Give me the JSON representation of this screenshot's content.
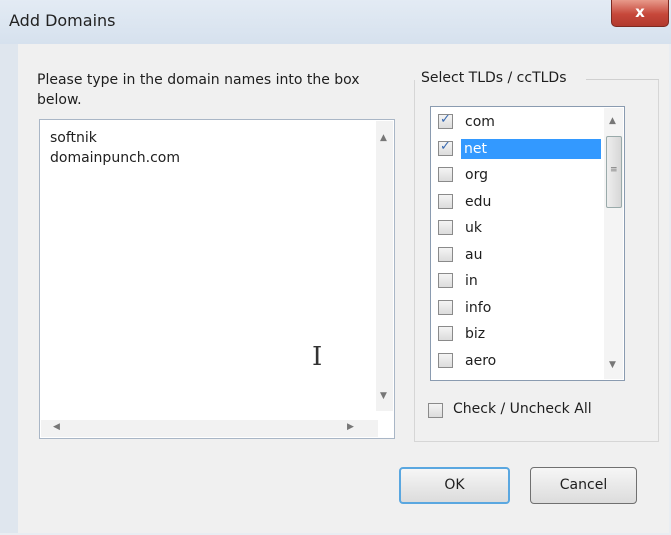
{
  "window": {
    "title": "Add Domains",
    "close_glyph": "x"
  },
  "prompt": "Please type in the domain names into the box below.",
  "textarea_lines": [
    "softnik",
    "domainpunch.com"
  ],
  "tld_group": {
    "label": "Select TLDs / ccTLDs",
    "items": [
      {
        "label": "com",
        "checked": true,
        "selected": false
      },
      {
        "label": "net",
        "checked": true,
        "selected": true
      },
      {
        "label": "org",
        "checked": false,
        "selected": false
      },
      {
        "label": "edu",
        "checked": false,
        "selected": false
      },
      {
        "label": "uk",
        "checked": false,
        "selected": false
      },
      {
        "label": "au",
        "checked": false,
        "selected": false
      },
      {
        "label": "in",
        "checked": false,
        "selected": false
      },
      {
        "label": "info",
        "checked": false,
        "selected": false
      },
      {
        "label": "biz",
        "checked": false,
        "selected": false
      },
      {
        "label": "aero",
        "checked": false,
        "selected": false
      }
    ],
    "check_all_label": "Check / Uncheck All",
    "check_all_checked": false
  },
  "buttons": {
    "ok": "OK",
    "cancel": "Cancel"
  },
  "colors": {
    "selection": "#3399ff",
    "close_button": "#c6473a",
    "ok_focus": "#5aa7e0"
  }
}
